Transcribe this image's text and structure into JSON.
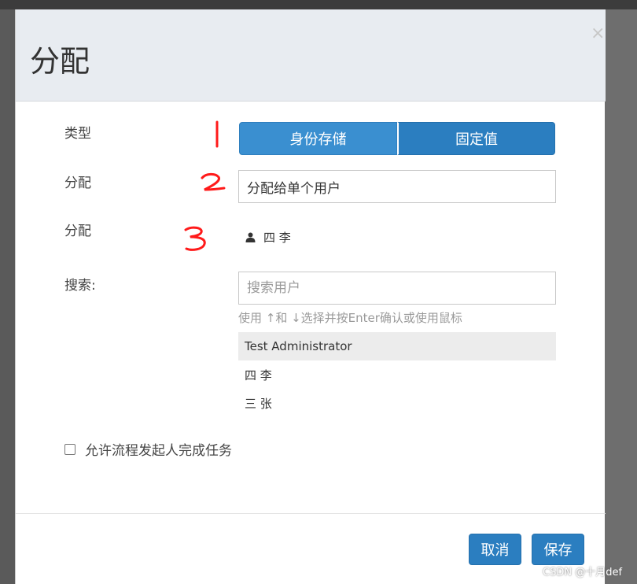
{
  "dialog": {
    "title": "分配",
    "close_label": "×"
  },
  "form": {
    "type_label": "类型",
    "type_options": [
      "身份存储",
      "固定值"
    ],
    "assign_label": "分配",
    "assign_value": "分配给单个用户",
    "assigned_label": "分配",
    "assigned_user": "四 李",
    "search_label": "搜索:",
    "search_placeholder": "搜索用户",
    "search_help": "使用 ↑和 ↓选择并按Enter确认或使用鼠标",
    "search_results": [
      "Test Administrator",
      "四 李",
      "三 张"
    ],
    "checkbox_label": "允许流程发起人完成任务"
  },
  "footer": {
    "cancel_label": "取消",
    "save_label": "保存"
  },
  "watermark": "CSDN @十月def",
  "colors": {
    "primary": "#2b7ec0",
    "primary_light": "#3a8fd0",
    "header_bg": "#e8ecf1",
    "annotation_red": "#ff1a1a"
  }
}
